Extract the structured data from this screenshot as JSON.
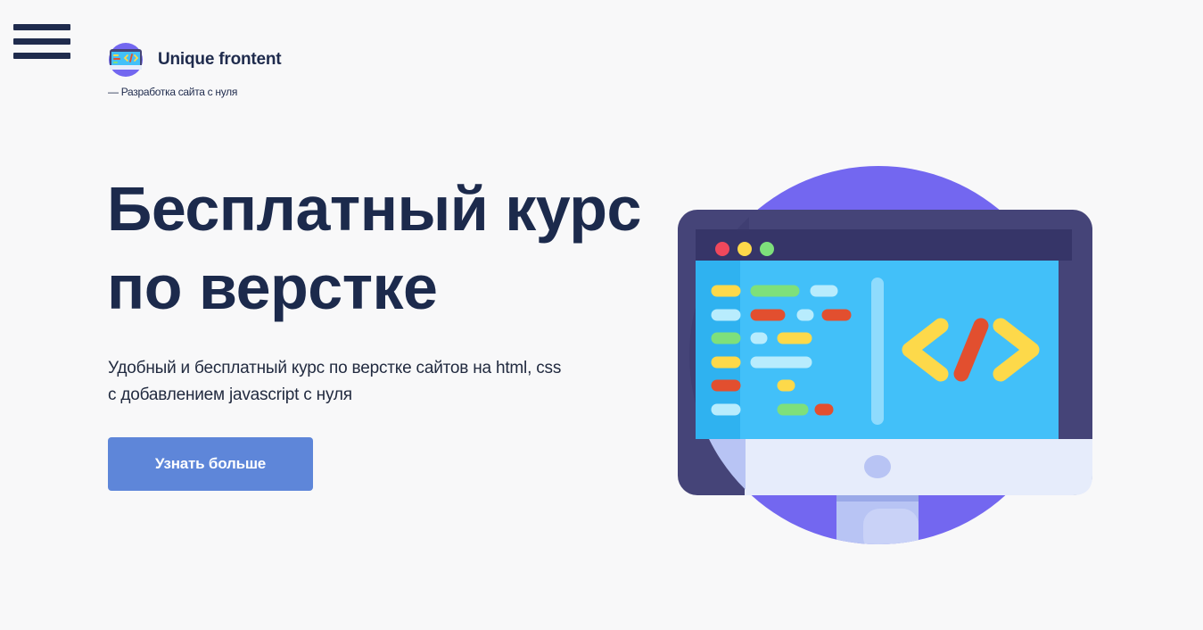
{
  "header": {
    "menu_icon": "hamburger-menu-icon",
    "logo_icon": "monitor-code-icon",
    "logo_name": "Unique frontent",
    "tagline": "— Разработка сайта с нуля"
  },
  "hero": {
    "title": "Бесплатный курс по верстке",
    "subtitle": "Удобный и бесплатный курс по верстке сайтов на html, css с добавлением javascript с нуля",
    "cta_label": "Узнать больше",
    "illustration_icon": "monitor-code-illustration"
  },
  "colors": {
    "background": "#f8f8f9",
    "text_dark": "#1c2a4c",
    "button": "#5e86d9",
    "circle": "#7367f0",
    "monitor_frame": "#454478",
    "screen": "#42c0f9",
    "code_yellow": "#fdd94a",
    "code_red": "#e24f2f"
  }
}
